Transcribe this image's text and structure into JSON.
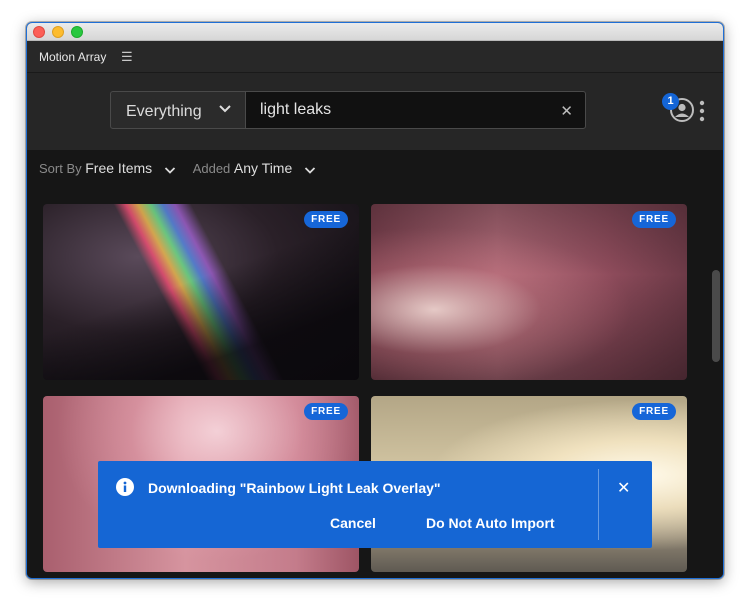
{
  "panel": {
    "title": "Motion Array",
    "menu_icon": "hamburger-icon"
  },
  "search": {
    "category": "Everything",
    "query": "light leaks",
    "clear_icon": "close-icon"
  },
  "account": {
    "notification_count": "1",
    "icon": "user-icon"
  },
  "sort": {
    "sort_by_label": "Sort By",
    "sort_by_value": "Free Items",
    "added_label": "Added",
    "added_value": "Any Time"
  },
  "results": [
    {
      "badge": "FREE"
    },
    {
      "badge": "FREE"
    },
    {
      "badge": "FREE"
    },
    {
      "badge": "FREE"
    }
  ],
  "toast": {
    "message": "Downloading \"Rainbow Light Leak Overlay\"",
    "cancel_label": "Cancel",
    "no_auto_import_label": "Do Not Auto Import",
    "close_icon": "close-icon"
  },
  "colors": {
    "accent": "#1566d4",
    "panel_bg": "#1e1e1e"
  }
}
